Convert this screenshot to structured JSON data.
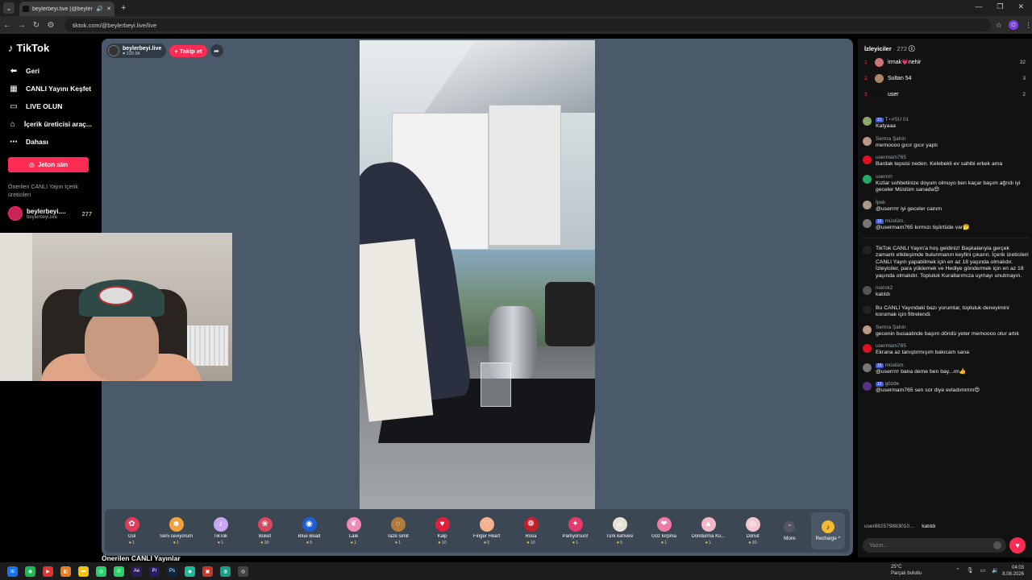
{
  "browser": {
    "tab_title": "beylerbeyi.live (@beylerbe",
    "url": "tiktok.com/@beylerbeyi.live/live",
    "profile_initial": "O"
  },
  "sidebar": {
    "logo": "TikTok",
    "back": "Geri",
    "items": [
      {
        "label": "CANLI Yayını Keşfet",
        "icon": "calendar-icon"
      },
      {
        "label": "LIVE OLUN",
        "icon": "camera-icon"
      },
      {
        "label": "İçerik üreticisi araç...",
        "icon": "tools-icon"
      },
      {
        "label": "Dahası",
        "icon": "more-icon"
      }
    ],
    "coins_button": "Jeton alın",
    "suggested_title": "Önerilen CANLI Yayın İçerik üreticileri",
    "creator": {
      "name": "beylerbeyi....",
      "handle": "beylerbeyi.live",
      "count": "277"
    }
  },
  "host": {
    "name": "beylerbeyi.live",
    "likes": "220.9K",
    "follow_label": "+ Takip et"
  },
  "gifts": [
    {
      "name": "Gül",
      "price": "1",
      "icon": "rose-icon",
      "color": "#e23b5a"
    },
    {
      "name": "Seni seviyorum",
      "price": "1",
      "icon": "love-face-icon",
      "color": "#f4a23a"
    },
    {
      "name": "TikTok",
      "price": "1",
      "icon": "tiktok-gift-icon",
      "color": "#c9a7f2"
    },
    {
      "name": "Buket",
      "price": "30",
      "icon": "bouquet-icon",
      "color": "#d9475d"
    },
    {
      "name": "Blue Bead",
      "price": "5",
      "icon": "blue-bead-icon",
      "color": "#1f5fd6"
    },
    {
      "name": "Lale",
      "price": "1",
      "icon": "tulip-icon",
      "color": "#f08bb5"
    },
    {
      "name": "Taze simit",
      "price": "1",
      "icon": "simit-icon",
      "color": "#b07a3c"
    },
    {
      "name": "Kalp",
      "price": "10",
      "icon": "heart-icon",
      "color": "#e0203c"
    },
    {
      "name": "Finger Heart",
      "price": "5",
      "icon": "finger-heart-icon",
      "color": "#f3b08a"
    },
    {
      "name": "Rosa",
      "price": "10",
      "icon": "rosa-icon",
      "color": "#c2202c"
    },
    {
      "name": "Parlıyorsun!",
      "price": "1",
      "icon": "shine-icon",
      "color": "#e33a6a"
    },
    {
      "name": "Türk kahvesi",
      "price": "5",
      "icon": "coffee-icon",
      "color": "#e8e2d6"
    },
    {
      "name": "Göz kırpma",
      "price": "1",
      "icon": "wink-icon",
      "color": "#f07aa6"
    },
    {
      "name": "Dondurma Kü...",
      "price": "1",
      "icon": "ice-cream-icon",
      "color": "#f2b8c8"
    },
    {
      "name": "Donut",
      "price": "30",
      "icon": "donut-icon",
      "color": "#f6c6d0"
    }
  ],
  "more_label": "More",
  "recharge_label": "Recharge ^",
  "below_title": "Önerilen CANLI Yayınlar",
  "chat": {
    "viewers_label": "İzleyiciler",
    "viewers_count": "· 272",
    "top_viewers": [
      {
        "rank": "1",
        "name": "irmak💗nehir",
        "score": "32"
      },
      {
        "rank": "2",
        "name": "Sultan 54",
        "score": "3"
      },
      {
        "rank": "3",
        "name": "user",
        "score": "2"
      }
    ],
    "messages": [
      {
        "user": "T⋆#SU 01",
        "badge": "21",
        "text": "Katyaaa",
        "color": "#8a6"
      },
      {
        "user": "Semra Şahin",
        "badge": "",
        "text": "memoooo gıcır gıcır yaptı",
        "color": "#b98"
      },
      {
        "user": "usermam765",
        "badge": "",
        "text": "Bardak tepsisi neden. Kelebekli ev sahibi erkek ama",
        "color": "#d12"
      },
      {
        "user": "userrrrr",
        "badge": "",
        "text": "Kızlar sohbetinize doyum olmuyo ben kaçar başım ağrıdı iyi geceler Müslüm sanada😍",
        "color": "#2a6"
      },
      {
        "user": "İpek",
        "badge": "",
        "text": "@userrrrr iyi geceler canım",
        "color": "#a98"
      },
      {
        "user": "müslüm.",
        "badge": "15",
        "text": "@usermam765 kırmızı tişörtüde var🤔",
        "color": "#777"
      },
      {
        "user": "",
        "badge": "",
        "text": "TikTok CANLI Yayın'a hoş geldiniz! Başkalarıyla gerçek zamanlı etkileşimde bulunmanın keyfini çıkarın. İçerik üreticileri CANLI Yayın yapabilmek için en az 18 yaşında olmalıdır. İzleyiciler, para yüklemek ve Hediye göndermek için en az 18 yaşında olmalıdır. Topluluk Kurallarımıza uymayı unutmayın.",
        "color": "#222"
      },
      {
        "user": "noirok2",
        "badge": "",
        "text": "katıldı",
        "color": "#555"
      },
      {
        "user": "",
        "badge": "",
        "text": "Bu CANLI Yayındaki bazı yorumlar, topluluk deneyimini korumak için filtrelendi.",
        "color": "#222"
      },
      {
        "user": "Semra Şahin",
        "badge": "",
        "text": "gecenin busaatinde başım döndü yeter memoooo otur artık",
        "color": "#b98"
      },
      {
        "user": "usermam765",
        "badge": "",
        "text": "Ekrana az tanıştırmışım bakıcam sana",
        "color": "#d12"
      },
      {
        "user": "müslüm.",
        "badge": "15",
        "text": "@userrrrr bana deme ben bay...ım👍",
        "color": "#777"
      },
      {
        "user": "gözde",
        "badge": "12",
        "text": "@usermam765 sen sor diye evladımmm😍",
        "color": "#538"
      }
    ],
    "joined_bottom_user": "user882579883010...",
    "joined_bottom_text": "katıldı",
    "input_placeholder": "Yazın..."
  },
  "taskbar": {
    "weather_temp": "25°C",
    "weather_desc": "Parçalı bulutlu",
    "time": "04:03",
    "date": "8.08.2026"
  }
}
